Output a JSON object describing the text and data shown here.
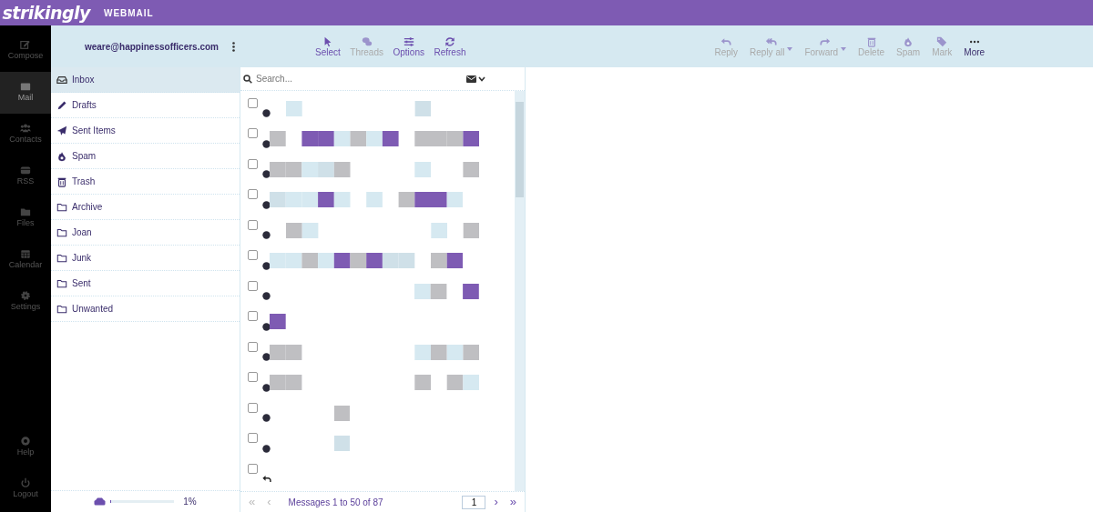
{
  "header": {
    "logo": "strikingly",
    "product": "WEBMAIL"
  },
  "rail": [
    {
      "label": "Compose",
      "selected": false
    },
    {
      "label": "Mail",
      "selected": true
    },
    {
      "label": "Contacts",
      "selected": false
    },
    {
      "label": "RSS",
      "selected": false
    },
    {
      "label": "Files",
      "selected": false
    },
    {
      "label": "Calendar",
      "selected": false
    },
    {
      "label": "Settings",
      "selected": false
    }
  ],
  "rail_bottom": [
    {
      "label": "Help",
      "selected": false
    },
    {
      "label": "Logout",
      "selected": false
    }
  ],
  "account": {
    "email": "weare@happinessofficers.com"
  },
  "folders": [
    {
      "label": "Inbox",
      "selected": true
    },
    {
      "label": "Drafts",
      "selected": false
    },
    {
      "label": "Sent Items",
      "selected": false
    },
    {
      "label": "Spam",
      "selected": false
    },
    {
      "label": "Trash",
      "selected": false
    },
    {
      "label": "Archive",
      "selected": false
    },
    {
      "label": "Joan",
      "selected": false
    },
    {
      "label": "Junk",
      "selected": false
    },
    {
      "label": "Sent",
      "selected": false
    },
    {
      "label": "Unwanted",
      "selected": false
    }
  ],
  "quota": {
    "level": 0.01,
    "reading": "1%"
  },
  "toolbar_left": [
    {
      "label": "Select",
      "disabled": false
    },
    {
      "label": "Threads",
      "disabled": true
    },
    {
      "label": "Options",
      "disabled": false
    },
    {
      "label": "Refresh",
      "disabled": false
    }
  ],
  "toolbar_right": [
    {
      "label": "Reply",
      "disabled": true,
      "dropdown": false
    },
    {
      "label": "Reply all",
      "disabled": true,
      "dropdown": true
    },
    {
      "label": "Forward",
      "disabled": true,
      "dropdown": true
    },
    {
      "label": "Delete",
      "disabled": true,
      "dropdown": false
    },
    {
      "label": "Spam",
      "disabled": true,
      "dropdown": false
    },
    {
      "label": "Mark",
      "disabled": true,
      "dropdown": false
    },
    {
      "label": "More",
      "disabled": false,
      "dropdown": false
    }
  ],
  "search": {
    "placeholder": "Search..."
  },
  "messages": [
    {
      "kind": "unread",
      "checked": false
    },
    {
      "kind": "unread",
      "checked": false
    },
    {
      "kind": "unread",
      "checked": false
    },
    {
      "kind": "unread",
      "checked": false
    },
    {
      "kind": "unread",
      "checked": false
    },
    {
      "kind": "unread",
      "checked": false
    },
    {
      "kind": "unread",
      "checked": false
    },
    {
      "kind": "unread",
      "checked": false
    },
    {
      "kind": "unread",
      "checked": false
    },
    {
      "kind": "unread",
      "checked": false
    },
    {
      "kind": "unread",
      "checked": false
    },
    {
      "kind": "unread",
      "checked": false
    },
    {
      "kind": "replied",
      "checked": false
    }
  ],
  "pager": {
    "first": "«",
    "prev": "‹",
    "summary": "Messages 1 to 50 of 87",
    "page": "1",
    "next": "›",
    "last": "»"
  }
}
